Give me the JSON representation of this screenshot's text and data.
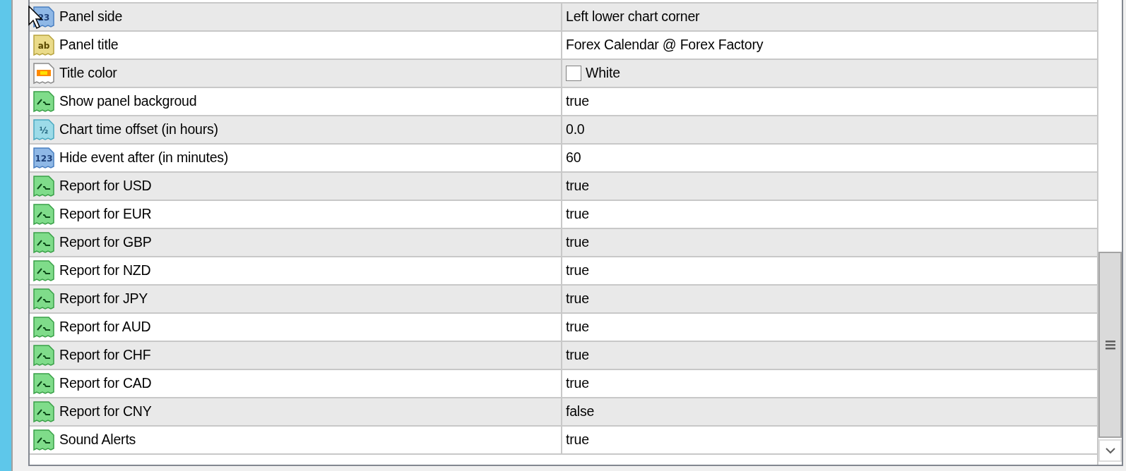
{
  "properties": [
    {
      "name": "Panel side",
      "value": "Left lower chart corner",
      "kind": "enum",
      "icon_label": "23"
    },
    {
      "name": "Panel title",
      "value": "Forex Calendar @ Forex Factory",
      "kind": "string",
      "icon_label": "ab"
    },
    {
      "name": "Title color",
      "value": "White",
      "kind": "color",
      "color": "#ffffff"
    },
    {
      "name": "Show panel backgroud",
      "value": "true",
      "kind": "bool"
    },
    {
      "name": "Chart time offset (in hours)",
      "value": "0.0",
      "kind": "double",
      "icon_label": "½"
    },
    {
      "name": "Hide event after (in minutes)",
      "value": "60",
      "kind": "int",
      "icon_label": "123"
    },
    {
      "name": "Report for USD",
      "value": "true",
      "kind": "bool"
    },
    {
      "name": "Report for EUR",
      "value": "true",
      "kind": "bool"
    },
    {
      "name": "Report for GBP",
      "value": "true",
      "kind": "bool"
    },
    {
      "name": "Report for NZD",
      "value": "true",
      "kind": "bool"
    },
    {
      "name": "Report for JPY",
      "value": "true",
      "kind": "bool"
    },
    {
      "name": "Report for AUD",
      "value": "true",
      "kind": "bool"
    },
    {
      "name": "Report for CHF",
      "value": "true",
      "kind": "bool"
    },
    {
      "name": "Report for CAD",
      "value": "true",
      "kind": "bool"
    },
    {
      "name": "Report for CNY",
      "value": "false",
      "kind": "bool"
    },
    {
      "name": "Sound Alerts",
      "value": "true",
      "kind": "bool"
    }
  ]
}
